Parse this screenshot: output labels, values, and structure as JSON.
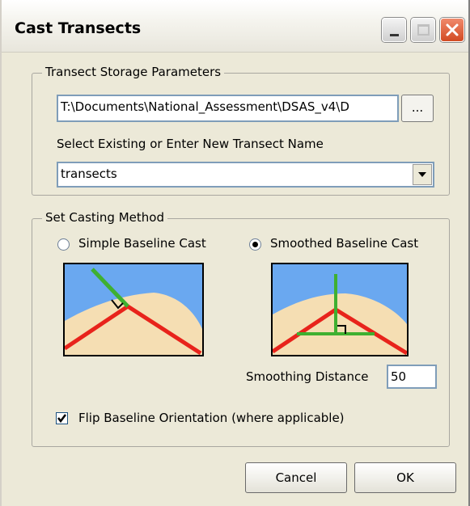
{
  "window": {
    "title": "Cast Transects",
    "controls": {
      "minimize_icon": "minimize-icon",
      "maximize_icon": "maximize-icon",
      "close_icon": "close-icon"
    }
  },
  "storage": {
    "group_label": "Transect Storage Parameters",
    "path_value": "T:\\Documents\\National_Assessment\\DSAS_v4\\D",
    "browse_label": "...",
    "select_label": "Select Existing or Enter New Transect Name",
    "transect_name": "transects"
  },
  "casting": {
    "group_label": "Set Casting Method",
    "simple_label": "Simple Baseline Cast",
    "smoothed_label": "Smoothed Baseline Cast",
    "selected": "smoothed",
    "smoothing_label": "Smoothing Distance",
    "smoothing_value": "50",
    "flip_label": "Flip Baseline Orientation (where applicable)",
    "flip_checked": true
  },
  "buttons": {
    "cancel": "Cancel",
    "ok": "OK"
  },
  "colors": {
    "sky": "#6aa8f0",
    "sand": "#f5deb3",
    "baseline": "#e8231b",
    "transect": "#3fb031",
    "dialog_bg": "#ece9d8"
  }
}
